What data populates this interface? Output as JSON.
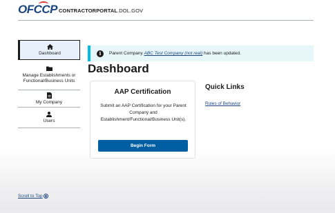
{
  "header": {
    "logo_text": "OFCCP",
    "site_name_bold": "CONTRACTORPORTAL",
    "site_name_domain": ".DOL.GOV"
  },
  "sidenav": {
    "items": [
      {
        "label": "Dashboard",
        "icon": "home-icon",
        "active": true
      },
      {
        "label": "Manage Establishments or Functional/Business Units",
        "icon": "folder-icon"
      },
      {
        "label": "My Company",
        "icon": "document-icon"
      },
      {
        "label": "Users",
        "icon": "user-icon"
      }
    ]
  },
  "alert": {
    "prefix": "Parent Company ",
    "link_text": "ABC Test Company (not real)",
    "suffix": " has been updated.",
    "icon": "info-icon"
  },
  "main": {
    "title": "Dashboard",
    "card": {
      "title": "AAP Certification",
      "body": "Submit an AAP Certification for your Parent Company and Establishment/Functional/Business Unit(s).",
      "button_label": "Begin Form"
    },
    "quick_links": {
      "title": "Quick Links",
      "links": [
        "Rules of Behavior"
      ]
    }
  },
  "footer": {
    "scroll_top_label": "Scroll to Top"
  },
  "colors": {
    "primary": "#005ea2",
    "link": "#1a4480",
    "alert_accent": "#00bde3",
    "alert_bg": "#e7f6f8",
    "nav_active_bg": "#e8f1fb"
  }
}
